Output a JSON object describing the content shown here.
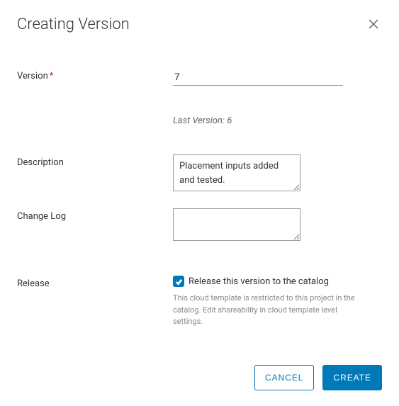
{
  "dialog": {
    "title": "Creating Version"
  },
  "form": {
    "version": {
      "label": "Version",
      "value": "7",
      "lastVersion": "Last Version: 6"
    },
    "description": {
      "label": "Description",
      "value": "Placement inputs added and tested."
    },
    "changelog": {
      "label": "Change Log",
      "value": ""
    },
    "release": {
      "label": "Release",
      "checkboxLabel": "Release this version to the catalog",
      "checked": true,
      "help": "This cloud template is restricted to this project in the catalog. Edit shareability in cloud template level settings."
    }
  },
  "buttons": {
    "cancel": "CANCEL",
    "create": "CREATE"
  }
}
